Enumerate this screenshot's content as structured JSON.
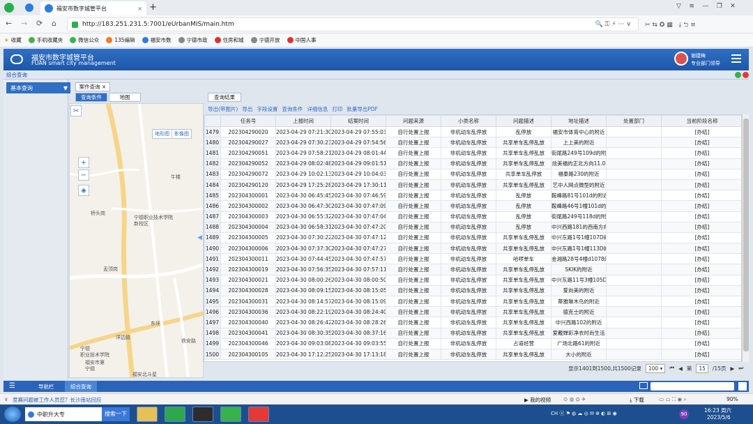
{
  "browser": {
    "tab_title": "福安市数字城管平台",
    "url": "http://183.251.231.5:7001/eUrbanMIS/main.htm",
    "bookmarks": [
      "收藏",
      "手机收藏夹",
      "微信公众",
      "135编辑",
      "福安市数",
      "宁德市政",
      "住房和城",
      "宁德开放",
      "中国人事"
    ]
  },
  "app": {
    "title_cn": "福安市数字城管平台",
    "title_en": "FUAN smart city management",
    "user_name": "谢捷梅",
    "user_dept": "专业部门领导"
  },
  "breadcrumb": "综合查询",
  "left_panel": {
    "basic_query": "基本查询"
  },
  "inner_tabs": {
    "case_query": "案件查询",
    "query_conditions": "查询条件",
    "map": "地图",
    "query_results": "查询结果"
  },
  "map": {
    "layer_map": "地形图",
    "layer_image": "影像图",
    "zoom_in": "+",
    "zoom_out": "−",
    "labels": [
      "宁德职业技术学院",
      "新校区",
      "桥头岗",
      "盂顶岗",
      "牛楼",
      "宁德",
      "职业技术学院",
      "福安市第",
      "宁德",
      "东坪",
      "洋边路",
      "铁安路",
      "福安北斗星"
    ]
  },
  "toolbar": [
    "导出(带图片)",
    "导出",
    "字段设置",
    "查询条件",
    "详细信息",
    "打印",
    "批量导出PDF"
  ],
  "table": {
    "headers": [
      "",
      "任务号",
      "上报时间",
      "结案时间",
      "问题来源",
      "小类名称",
      "问题描述",
      "地址描述",
      "处置部门",
      "当前阶段名称"
    ],
    "rows": [
      [
        "1479",
        "202304290020",
        "2023-04-29 07:21:30",
        "2023-04-29 07:55:03",
        "自行处置上报",
        "非机动车乱停放",
        "乱停放",
        "福安市体育中心的附近",
        "",
        "[办结]"
      ],
      [
        "1480",
        "202304290027",
        "2023-04-29 07:30:23",
        "2023-04-29 07:54:56",
        "自行处置上报",
        "非机动车乱停放",
        "共享单车乱停乱放",
        "上上美的附近",
        "",
        "[办结]"
      ],
      [
        "1481",
        "202304290051",
        "2023-04-29 07:58:21",
        "2023-04-29 08:01:44",
        "自行处置上报",
        "非机动车乱停放",
        "共享单车乱停乱放",
        "街尾路249号109d的附近",
        "",
        "[办结]"
      ],
      [
        "1482",
        "202304290052",
        "2023-04-29 08:02:48",
        "2023-04-29 09:01:51",
        "自行处置上报",
        "非机动车乱停放",
        "共享单车乱停乱放",
        "炫美福的正北方向11.0",
        "",
        "[办结]"
      ],
      [
        "1483",
        "202304290072",
        "2023-04-29 10:02:13",
        "2023-04-29 10:04:03",
        "自行处置上报",
        "非机动车乱停放",
        "共享单车乱停放",
        "福泰路230的附近",
        "",
        "[办结]"
      ],
      [
        "1484",
        "202304290120",
        "2023-04-29 17:25:28",
        "2023-04-29 17:30:11",
        "自行处置上报",
        "非机动车乱停放",
        "共享单车乱停乱放",
        "艺中人网点微型的附近",
        "",
        "[办结]"
      ],
      [
        "1485",
        "202304300001",
        "2023-04-30 06:45:45",
        "2023-04-30 07:46:59",
        "自行处置上报",
        "非机动车乱停放",
        "乱停放",
        "鞍峰路81号101d的附近",
        "",
        "[办结]"
      ],
      [
        "1486",
        "202304300002",
        "2023-04-30 06:47:30",
        "2023-04-30 07:47:09",
        "自行处置上报",
        "非机动车乱停放",
        "乱停放",
        "鞍峰路46号1幢101d的附",
        "",
        "[办结]"
      ],
      [
        "1487",
        "202304300003",
        "2023-04-30 06:55:32",
        "2023-04-30 07:47:04",
        "自行处置上报",
        "非机动车乱停放",
        "乱停放",
        "街尾路249号118d的附近",
        "",
        "[办结]"
      ],
      [
        "1488",
        "202304300004",
        "2023-04-30 06:58:31",
        "2023-04-30 07:47:20",
        "自行处置上报",
        "非机动车乱停放",
        "乱停放",
        "中兴西路181的西南方向",
        "",
        "[办结]"
      ],
      [
        "1489",
        "202304300005",
        "2023-04-30 07:30:22",
        "2023-04-30 07:47:12",
        "自行处置上报",
        "非机动车乱停放",
        "共享单车乱停乱放",
        "中兴东路1号1幢107D的",
        "",
        "[办结]"
      ],
      [
        "1490",
        "202304300006",
        "2023-04-30 07:37:30",
        "2023-04-30 07:47:27",
        "自行处置上报",
        "非机动车乱停放",
        "共享单车乱停乱放",
        "中兴东路1号1幢113D的",
        "",
        "[办结]"
      ],
      [
        "1491",
        "202304300011",
        "2023-04-30 07:44:45",
        "2023-04-30 07:47:57",
        "自行处置上报",
        "非机动车乱停放",
        "哈啰单车",
        "金湘路28号4幢d1078的",
        "",
        "[办结]"
      ],
      [
        "1492",
        "202304300019",
        "2023-04-30 07:56:35",
        "2023-04-30 07:57:11",
        "自行处置上报",
        "非机动车乱停放",
        "共享单车乱停乱放",
        "SKIK的附近",
        "",
        "[办结]"
      ],
      [
        "1493",
        "202304300021",
        "2023-04-30 08:00:26",
        "2023-04-30 08:00:50",
        "自行处置上报",
        "非机动车乱停放",
        "共享单车乱停乱放",
        "中兴东路11号3幢105D",
        "",
        "[办结]"
      ],
      [
        "1494",
        "202304300028",
        "2023-04-30 08:09:15",
        "2023-04-30 08:15:05",
        "自行处置上报",
        "非机动车乱停放",
        "共享单车乱停乱放",
        "爱尚美的附近",
        "",
        "[办结]"
      ],
      [
        "1495",
        "202304300031",
        "2023-04-30 08:14:57",
        "2023-04-30 08:15:09",
        "自行处置上报",
        "非机动车乱停放",
        "共享单车乱停乱放",
        "蒂雅琳木鸟的附近",
        "",
        "[办结]"
      ],
      [
        "1496",
        "202304300036",
        "2023-04-30 08:22:19",
        "2023-04-30 08:24:40",
        "自行处置上报",
        "非机动车乱停放",
        "共享单车乱停乱放",
        "德克士的附近",
        "",
        "[办结]"
      ],
      [
        "1497",
        "202304300040",
        "2023-04-30 08:26:42",
        "2023-04-30 08:28:26",
        "自行处置上报",
        "非机动车乱停放",
        "共享单车乱停乱放",
        "中兴西路102的附近",
        "",
        "[办结]"
      ],
      [
        "1498",
        "202304300041",
        "2023-04-30 08:30:35",
        "2023-04-30 08:37:16",
        "自行处置上报",
        "非机动车乱停放",
        "共享单车乱停乱放",
        "爱戴婵彩净衣时尚生活",
        "",
        "[办结]"
      ],
      [
        "1499",
        "202304300046",
        "2023-04-30 09:03:08",
        "2023-04-30 09:03:55",
        "自行处置上报",
        "非机动车乱停放",
        "占道经营",
        "广场北路61的附近",
        "",
        "[办结]"
      ],
      [
        "1500",
        "202304300105",
        "2023-04-30 17:12:25",
        "2023-04-30 17:13:18",
        "自行处置上报",
        "非机动车乱停放",
        "共享单车乱停乱放",
        "大小的附近",
        "",
        "[办结]"
      ]
    ]
  },
  "pager": {
    "summary": "显示1401到1500,共1500记录",
    "page_size": "100",
    "page_label": "第",
    "page_current": "15",
    "page_total": "/15页"
  },
  "app_footer": {
    "nav": "导航栏",
    "tab": "综合查询"
  },
  "status_bar": {
    "left": "竞赛问题被工作人员怼？长沙南站回应",
    "video": "我的视频",
    "download": "下载",
    "zoom": "90%"
  },
  "taskbar": {
    "browser_label": "中职升大专",
    "search": "搜索一下",
    "time": "16:23 周六",
    "date": "2023/5/6",
    "badge": "90"
  }
}
